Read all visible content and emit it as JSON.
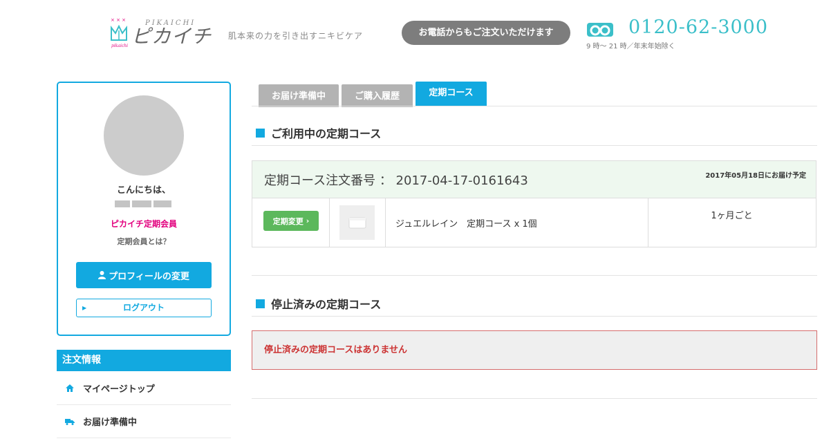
{
  "header": {
    "logo_roman": "PIKAICHI",
    "logo_text": "ピカイチ",
    "logo_tagline": "肌本来の力を引き出すニキビケア",
    "phone_order_label": "お電話からもご注文いただけます",
    "phone_number": "0120-62-3000",
    "phone_hours": "9 時〜 21 時／年末年始除く"
  },
  "profile": {
    "greeting": "こんにちは、",
    "member_type": "ピカイチ定期会員",
    "member_about": "定期会員とは？",
    "profile_button": "プロフィールの変更",
    "logout_button": "ログアウト"
  },
  "nav": {
    "heading": "注文情報",
    "items": [
      {
        "label": "マイページトップ",
        "icon": "home-icon"
      },
      {
        "label": "お届け準備中",
        "icon": "truck-icon"
      }
    ]
  },
  "tabs": [
    {
      "label": "お届け準備中",
      "active": false
    },
    {
      "label": "ご購入履歴",
      "active": false
    },
    {
      "label": "定期コース",
      "active": true
    }
  ],
  "active_section": {
    "title": "ご利用中の定期コース",
    "order_number_label": "定期コース注文番号 ： 2017-04-17-0161643",
    "delivery_date": "2017年05月18日にお届け予定",
    "change_button": "定期変更",
    "product": "ジュエルレイン　定期コース x 1個",
    "cycle": "1ヶ月ごと"
  },
  "stopped_section": {
    "title": "停止済みの定期コース",
    "empty_message": "停止済みの定期コースはありません"
  },
  "colors": {
    "accent": "#12a9e0",
    "member_pink": "#e2007e",
    "change_green": "#5cb85c",
    "phone_teal": "#3bbfc9",
    "alert_red": "#cc3333"
  }
}
